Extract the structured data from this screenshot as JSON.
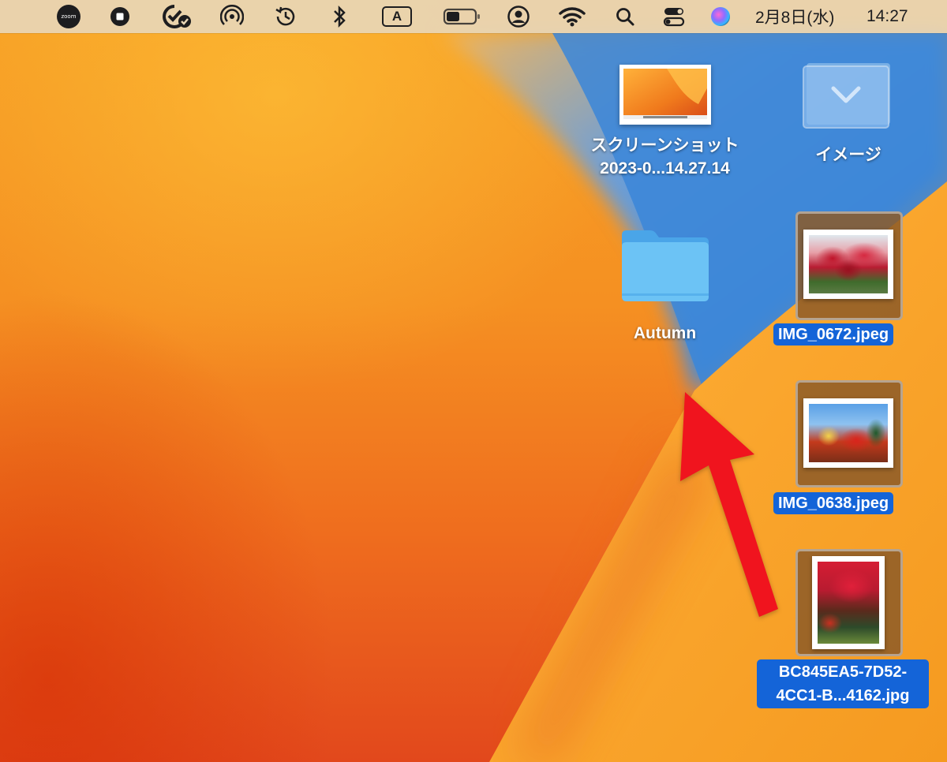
{
  "menubar": {
    "status_icons": [
      "zoom-icon",
      "stop-recording-icon",
      "focus-check-icon",
      "airdrop-broadcast-icon",
      "time-machine-icon",
      "bluetooth-icon",
      "input-method-icon",
      "battery-icon",
      "user-account-icon",
      "wifi-icon",
      "spotlight-search-icon",
      "control-center-icon",
      "siri-icon"
    ],
    "zoom_label": "zoom",
    "input_method_label": "A",
    "date": "2月8日(水)",
    "time": "14:27"
  },
  "desktop": {
    "items": [
      {
        "name": "screenshot-file",
        "label_line1": "スクリーンショット",
        "label_line2": "2023-0...14.27.14",
        "selected": false
      },
      {
        "name": "image-volume",
        "label": "イメージ",
        "selected": false
      },
      {
        "name": "folder-autumn",
        "label": "Autumn",
        "selected": false
      },
      {
        "name": "file-img-0672",
        "label": "IMG_0672.jpeg",
        "selected": true
      },
      {
        "name": "file-img-0638",
        "label": "IMG_0638.jpeg",
        "selected": true
      },
      {
        "name": "file-bc845ea5",
        "label_line1": "BC845EA5-7D52-",
        "label_line2": "4CC1-B...4162.jpg",
        "selected": true
      }
    ]
  },
  "colors": {
    "selection_blue": "#1464d8",
    "annotation_arrow": "#f0141e",
    "folder_blue": "#6cc3f5"
  }
}
